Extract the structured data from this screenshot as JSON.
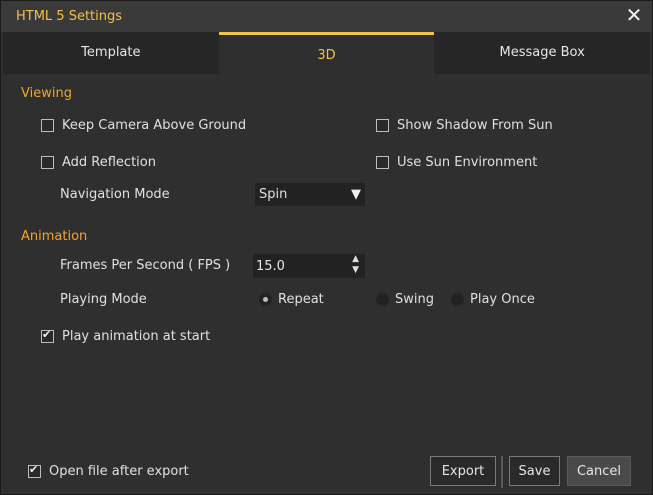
{
  "window": {
    "title": "HTML 5 Settings",
    "close_label": "✕"
  },
  "tabs": [
    {
      "label": "Template"
    },
    {
      "label": "3D"
    },
    {
      "label": "Message Box"
    }
  ],
  "viewing": {
    "heading": "Viewing",
    "keep_camera": {
      "label": "Keep Camera Above Ground",
      "checked": false
    },
    "show_shadow": {
      "label": "Show Shadow From Sun",
      "checked": false
    },
    "add_reflection": {
      "label": "Add Reflection",
      "checked": false
    },
    "sun_env": {
      "label": "Use Sun Environment",
      "checked": false
    },
    "nav_mode_label": "Navigation Mode",
    "nav_mode_value": "Spin",
    "nav_mode_arrow": "▼"
  },
  "animation": {
    "heading": "Animation",
    "fps_label": "Frames Per Second ( FPS )",
    "fps_value": "15.0",
    "fps_arrows": "▲\n▼",
    "playing_mode_label": "Playing Mode",
    "modes": [
      {
        "label": "Repeat",
        "selected": true
      },
      {
        "label": "Swing",
        "selected": false
      },
      {
        "label": "Play Once",
        "selected": false
      }
    ],
    "play_at_start": {
      "label": "Play animation at start",
      "checked": true
    }
  },
  "footer": {
    "open_file": {
      "label": "Open file after export",
      "checked": true
    },
    "export_label": "Export",
    "save_label": "Save",
    "cancel_label": "Cancel"
  },
  "colors": {
    "accent": "#f2c14a",
    "section": "#f0a630",
    "background": "#2f2f2f"
  }
}
